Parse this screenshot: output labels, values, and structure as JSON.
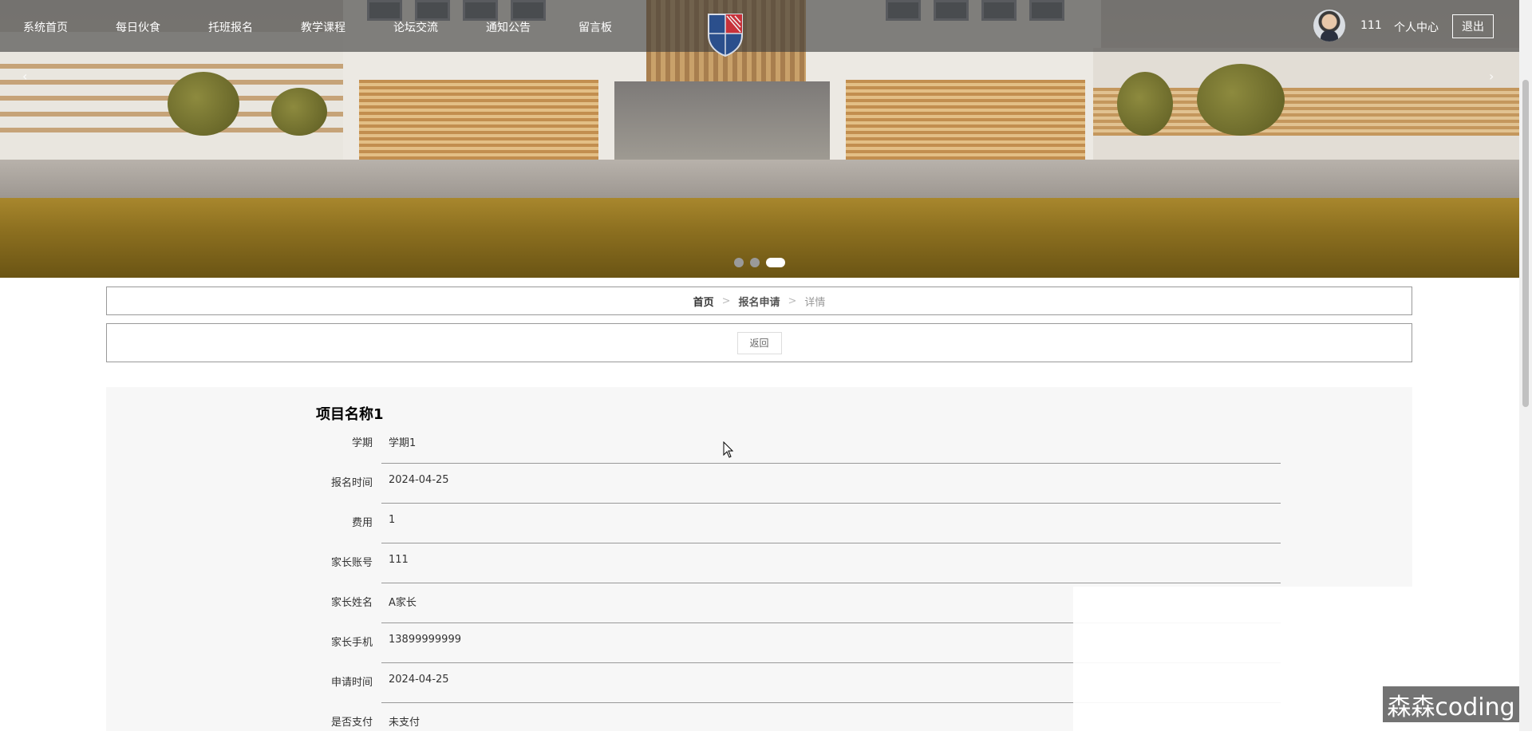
{
  "nav": {
    "items": [
      "系统首页",
      "每日伙食",
      "托班报名",
      "教学课程",
      "论坛交流",
      "通知公告",
      "留言板"
    ],
    "user_name": "111",
    "user_center": "个人中心",
    "logout": "退出"
  },
  "carousel": {
    "prev_icon": "‹",
    "next_icon": "›",
    "slide_count": 3,
    "active_slide": 3
  },
  "breadcrumb": {
    "home": "首页",
    "section": "报名申请",
    "current": "详情",
    "separator": ">"
  },
  "back_label": "返回",
  "detail": {
    "title": "项目名称1",
    "fields": [
      {
        "label": "学期",
        "value": "学期1"
      },
      {
        "label": "报名时间",
        "value": "2024-04-25"
      },
      {
        "label": "费用",
        "value": "1"
      },
      {
        "label": "家长账号",
        "value": "111"
      },
      {
        "label": "家长姓名",
        "value": "A家长"
      },
      {
        "label": "家长手机",
        "value": "13899999999"
      },
      {
        "label": "申请时间",
        "value": "2024-04-25"
      },
      {
        "label": "是否支付",
        "value": "未支付"
      }
    ]
  },
  "watermark": "森森coding",
  "colors": {
    "nav_bg": "#3c3c3c",
    "panel_bg": "#f7f7f7",
    "border": "#999999"
  }
}
